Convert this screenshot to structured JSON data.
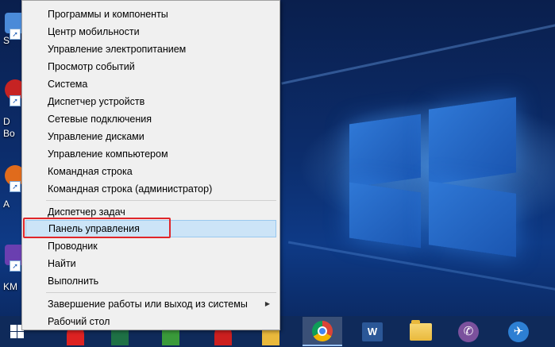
{
  "desktop": {
    "icon_labels": [
      "S",
      "D\nBo",
      "A",
      "KM"
    ]
  },
  "context_menu": {
    "group1": [
      "Программы и компоненты",
      "Центр мобильности",
      "Управление электропитанием",
      "Просмотр событий",
      "Система",
      "Диспетчер устройств",
      "Сетевые подключения",
      "Управление дисками",
      "Управление компьютером",
      "Командная строка",
      "Командная строка (администратор)"
    ],
    "group2": [
      "Диспетчер задач",
      "Панель управления",
      "Проводник",
      "Найти",
      "Выполнить"
    ],
    "group3": [
      "Завершение работы или выход из системы",
      "Рабочий стол"
    ],
    "highlighted_item": "Панель управления",
    "submenu_arrow": "▶"
  },
  "taskbar": {
    "apps": [
      "chrome-icon",
      "word-icon",
      "explorer-icon",
      "viber-icon",
      "bird-app-icon"
    ],
    "word_letter": "W",
    "viber_glyph": "✆",
    "bird_glyph": "✈"
  },
  "colors": {
    "highlight_bg": "#cce4f7",
    "annotation_red": "#e0262a",
    "taskbar": "#0f2a5a"
  }
}
